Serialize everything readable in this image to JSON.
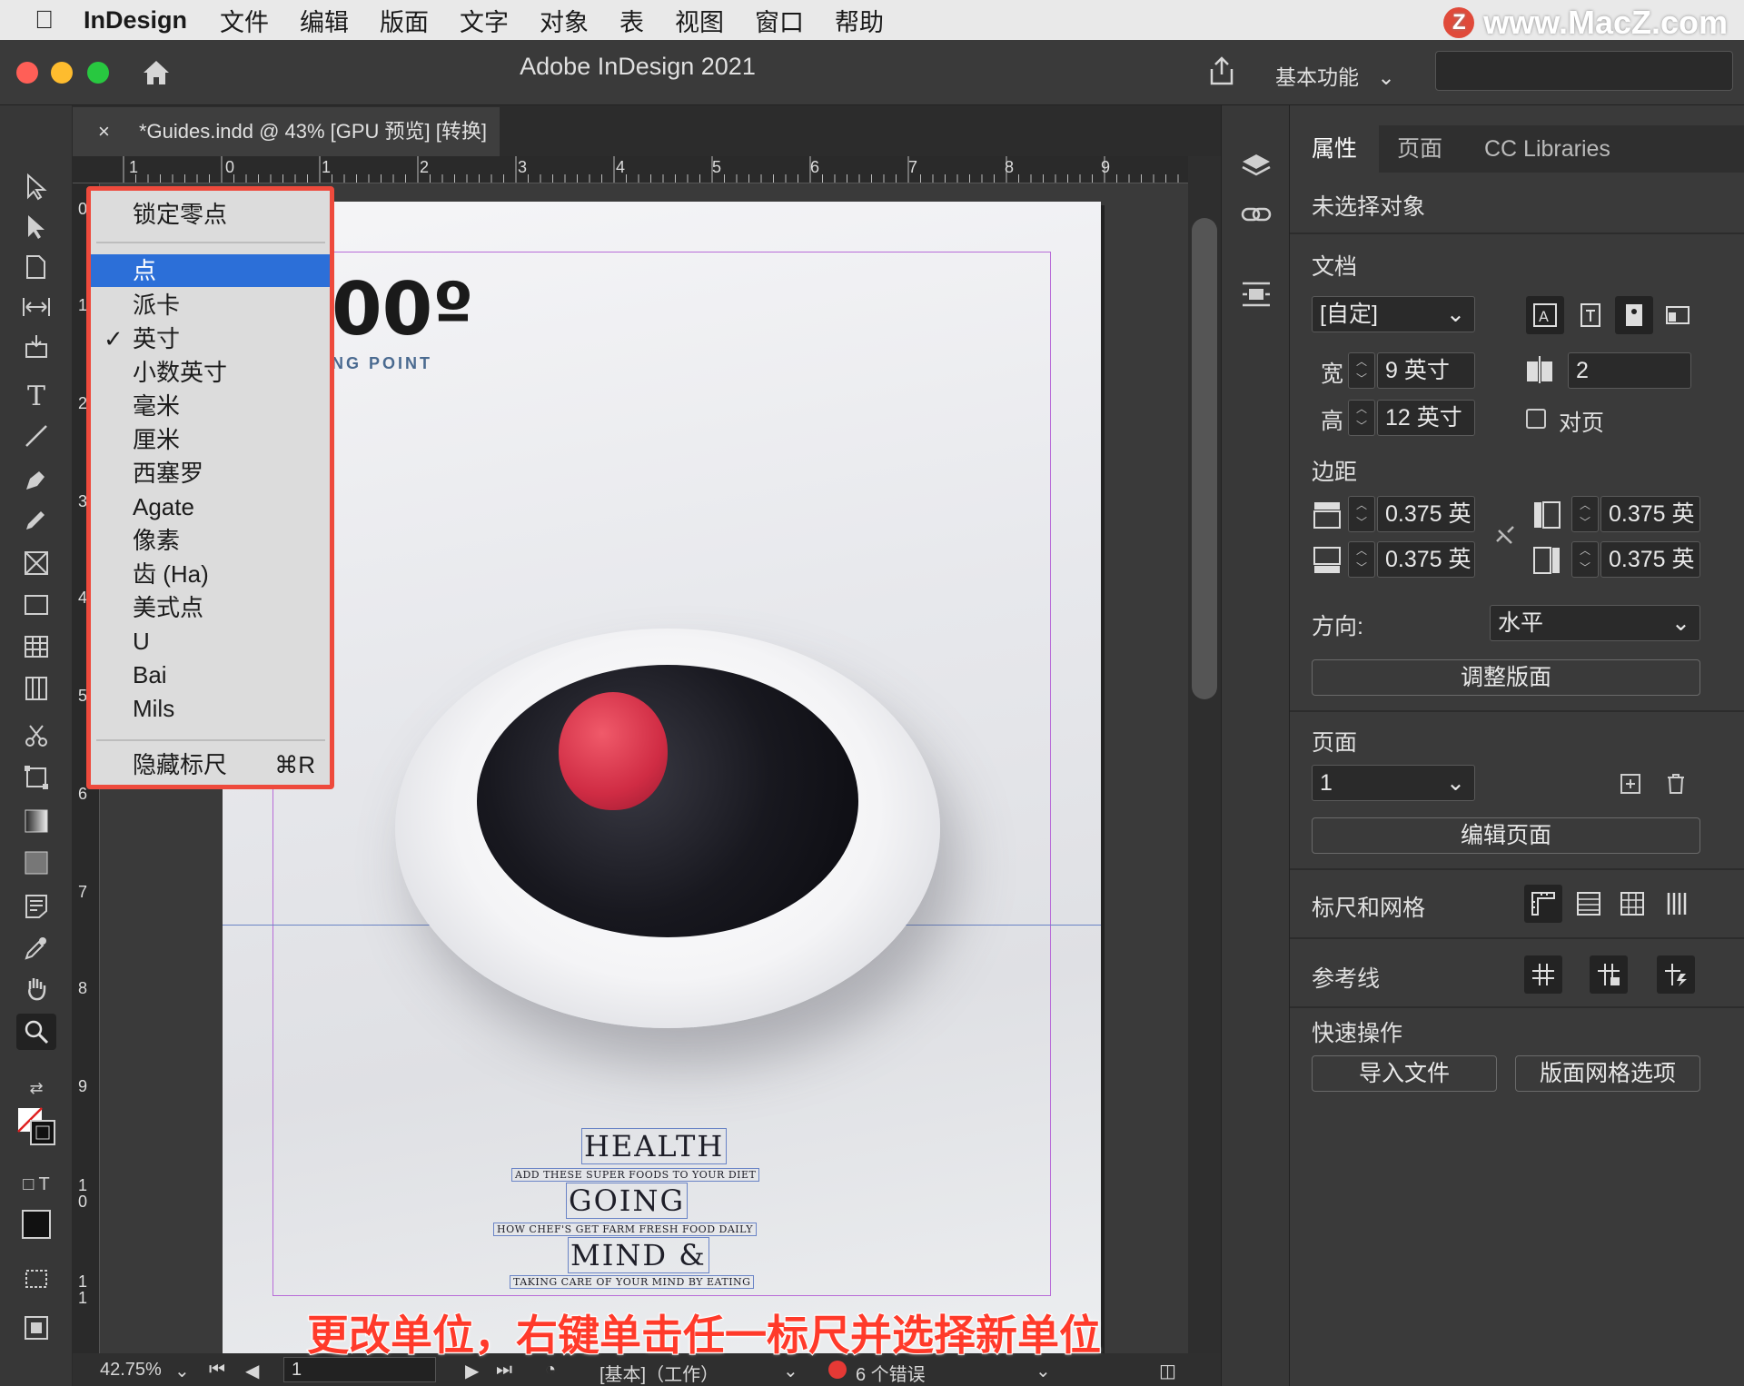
{
  "menubar": {
    "app_name": "InDesign",
    "items": [
      "文件",
      "编辑",
      "版面",
      "文字",
      "对象",
      "表",
      "视图",
      "窗口",
      "帮助"
    ],
    "watermark": "www.MacZ.com",
    "watermark_logo": "Z"
  },
  "window": {
    "title": "Adobe InDesign 2021",
    "workspace": "基本功能"
  },
  "document_tab": {
    "close": "×",
    "title": "*Guides.indd @ 43% [GPU 预览] [转换]"
  },
  "ruler": {
    "h_labels": [
      "1",
      "0",
      "1",
      "2",
      "3",
      "4",
      "5",
      "6",
      "7",
      "8",
      "9"
    ],
    "v_labels": [
      "0",
      "1",
      "2",
      "3",
      "4",
      "5",
      "6",
      "7",
      "8",
      "9",
      "1 0",
      "1 1"
    ]
  },
  "context_menu": {
    "lock_zero": "锁定零点",
    "units": [
      {
        "label": "点",
        "selected": true,
        "checked": false
      },
      {
        "label": "派卡",
        "selected": false,
        "checked": false
      },
      {
        "label": "英寸",
        "selected": false,
        "checked": true
      },
      {
        "label": "小数英寸",
        "selected": false,
        "checked": false
      },
      {
        "label": "毫米",
        "selected": false,
        "checked": false
      },
      {
        "label": "厘米",
        "selected": false,
        "checked": false
      },
      {
        "label": "西塞罗",
        "selected": false,
        "checked": false
      },
      {
        "label": "Agate",
        "selected": false,
        "checked": false
      },
      {
        "label": "像素",
        "selected": false,
        "checked": false
      },
      {
        "label": "齿 (Ha)",
        "selected": false,
        "checked": false
      },
      {
        "label": "美式点",
        "selected": false,
        "checked": false
      },
      {
        "label": "U",
        "selected": false,
        "checked": false
      },
      {
        "label": "Bai",
        "selected": false,
        "checked": false
      },
      {
        "label": "Mils",
        "selected": false,
        "checked": false
      }
    ],
    "checkmark": "✓",
    "hide_rulers": "隐藏标尺",
    "hide_rulers_shortcut": "⌘R"
  },
  "page_content": {
    "headline": "00º",
    "subheadline": "NG POINT",
    "blocks": [
      {
        "title": "HEALTH",
        "subtitle": "ADD THESE SUPER FOODS TO YOUR DIET"
      },
      {
        "title": "GOING",
        "subtitle": "HOW CHEF'S GET FARM FRESH FOOD DAILY"
      },
      {
        "title": "MIND &",
        "subtitle": "TAKING CARE OF YOUR MIND BY EATING"
      }
    ]
  },
  "statusbar": {
    "zoom": "42.75%",
    "page": "1",
    "profile": "[基本]（工作）",
    "errors": "6 个错误",
    "error_color": "#e53935"
  },
  "properties": {
    "tabs": [
      "属性",
      "页面",
      "CC Libraries"
    ],
    "active_tab": "属性",
    "no_selection": "未选择对象",
    "document_label": "文档",
    "preset": "[自定]",
    "width_label": "宽",
    "width_value": "9 英寸",
    "height_label": "高",
    "height_value": "12 英寸",
    "pages_count": "2",
    "facing_pages": "对页",
    "margins_label": "边距",
    "margin_top": "0.375 英",
    "margin_bottom": "0.375 英",
    "margin_left": "0.375 英",
    "margin_right": "0.375 英",
    "orientation_label": "方向:",
    "orientation_value": "水平",
    "adjust_layout": "调整版面",
    "pages_label": "页面",
    "page_value": "1",
    "edit_page": "编辑页面",
    "rulers_grids": "标尺和网格",
    "guides": "参考线",
    "quick_actions": "快速操作",
    "import_file": "导入文件",
    "layout_grid_options": "版面网格选项"
  },
  "caption": "更改单位，右键单击任一标尺并选择新单位"
}
